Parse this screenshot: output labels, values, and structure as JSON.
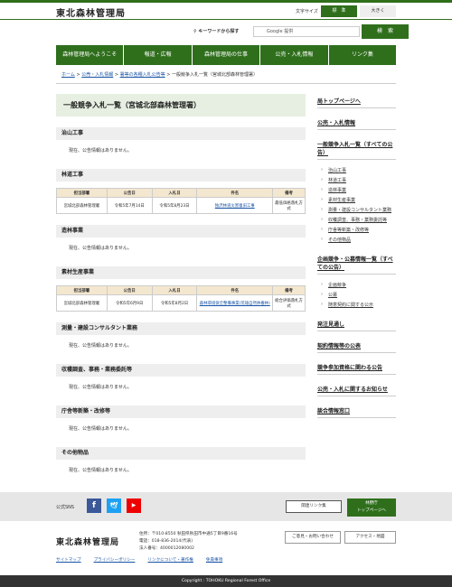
{
  "header": {
    "site_title": "東北森林管理局",
    "font_size_label": "文字サイズ",
    "font_std": "標　準",
    "font_large": "大きく"
  },
  "search": {
    "label": "キーワードから探す",
    "engine": "Google 提供",
    "button": "検　索"
  },
  "gnav": [
    "森林管理局へようこそ",
    "報道・広報",
    "森林管理局の仕事",
    "公売・入札情報",
    "リンク集"
  ],
  "breadcrumb": {
    "home": "ホーム",
    "sep": " > ",
    "c1": "公売・入札情報",
    "c2": "署等の各種入札公告等",
    "current": "一般競争入札一覧（宮城北部森林管理署）"
  },
  "main": {
    "title": "一般競争入札一覧（宮城北部森林管理署）",
    "no_notice": "現在、公告情報はありません。",
    "columns": [
      "担当部署",
      "公告日",
      "入札日",
      "件名",
      "備考"
    ],
    "sections": {
      "s1": "治山工事",
      "s2": "林道工事",
      "s3": "造林事業",
      "s4": "素材生産事業",
      "s5": "測量・建設コンサルタント業務",
      "s6": "収穫調査、事務・業務委託等",
      "s7": "庁舎等新築・改修等",
      "s8": "その他物品"
    },
    "rows": {
      "r1": {
        "dept": "宮城北部森林管理署",
        "notice": "令和5年7月14日",
        "bid": "令和5年8月23日",
        "title": "独沢林道災害復旧工事",
        "remark": "最低価格落札方式"
      },
      "r2": {
        "dept": "宮城北部森林管理署",
        "notice": "令和5年6月9日",
        "bid": "令和5年8月2日",
        "title": "森林環境保全整備事業(荒雄自然休養林)",
        "remark": "総合評価落札方式"
      }
    }
  },
  "side": {
    "top": "局トップページへ",
    "bid_info": "公売・入札情報",
    "general_list": "一般競争入札一覧（すべての公告）",
    "subs1": [
      "治山工事",
      "林道工事",
      "造林事業",
      "素材生産事業",
      "測量・建設コンサルタント業務",
      "収穫調査、事務・業務委託等",
      "庁舎等新築・改修等",
      "その他物品"
    ],
    "planning": "企画競争・公募情報一覧（すべての公告）",
    "subs2": [
      "企画競争",
      "公募",
      "随意契約に関する公示"
    ],
    "orders": "発注見通し",
    "contracts": "契約情報等の公表",
    "qualification": "競争参加資格に関わる公告",
    "inquiry": "公売・入札に関するお知らせ",
    "counter": "談合情報窓口"
  },
  "footer": {
    "sns_label": "公式SNS",
    "links_btn": "関連リンク集",
    "agency_btn_1": "林野庁",
    "agency_btn_2": "トップページへ",
    "org_name": "東北森林管理局",
    "address": "住所：〒010-8550 秋田県秋田市中通5丁目9番16号",
    "phone": "電話：018-836-2014(代表)",
    "corp_no": "法人番号：4000012080002",
    "contact_btn": "ご意見・お問い合わせ",
    "access_btn": "アクセス・地図",
    "links": [
      "サイトマップ",
      "プライバシーポリシー",
      "リンクについて・著作権",
      "免責事項"
    ],
    "copyright": "Copyright : TOHOKU Regional Forest Office"
  },
  "colors": {
    "brand_green": "#2f6f1c",
    "title_bg": "#e6efe1",
    "table_head": "#f4e7cf",
    "link": "#1a55a5"
  }
}
